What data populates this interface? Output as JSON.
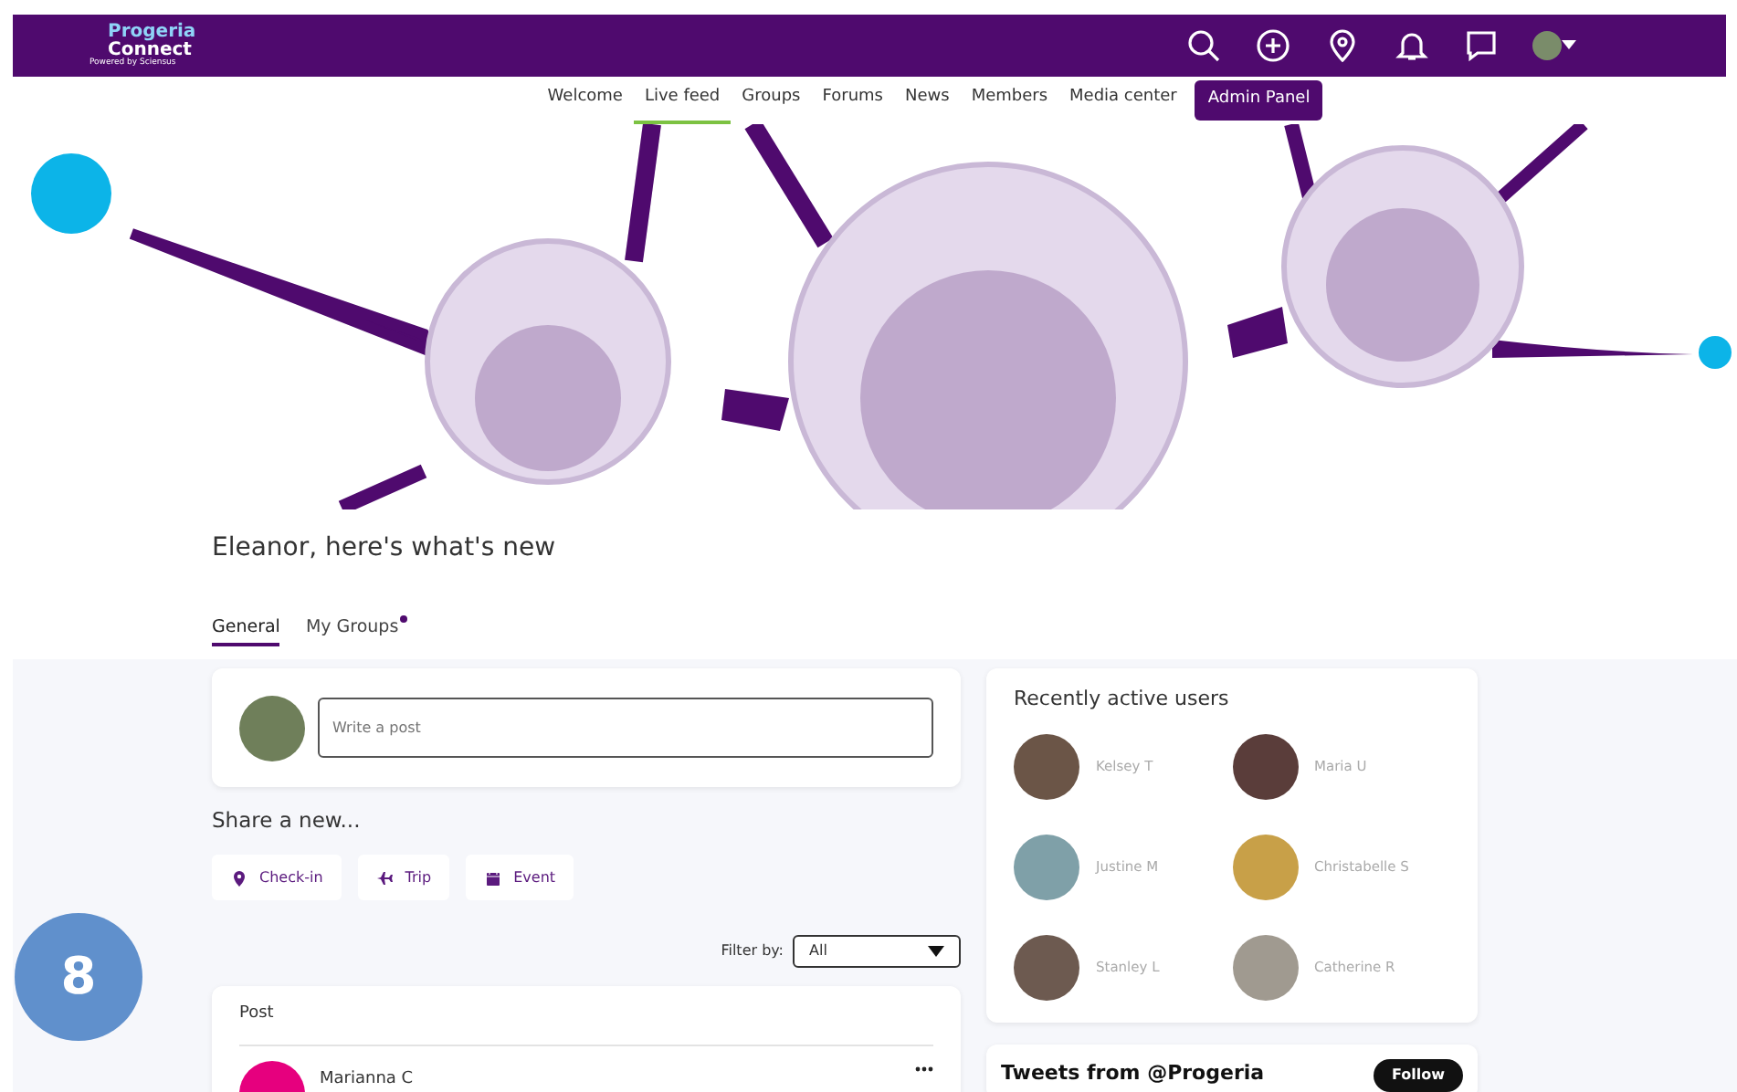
{
  "brand": {
    "line1": "Progeria",
    "line2": "Connect",
    "tagline": "Powered by Sciensus"
  },
  "top_icons": [
    {
      "kind": "search"
    },
    {
      "kind": "plus"
    },
    {
      "kind": "pin"
    },
    {
      "kind": "bell"
    },
    {
      "kind": "chat"
    },
    {
      "kind": "avatar"
    }
  ],
  "nav": [
    {
      "label": "Welcome",
      "selected": false
    },
    {
      "label": "Live feed",
      "selected": true
    },
    {
      "label": "Groups",
      "selected": false
    },
    {
      "label": "Forums",
      "selected": false
    },
    {
      "label": "News",
      "selected": false
    },
    {
      "label": "Members",
      "selected": false
    },
    {
      "label": "Media center",
      "selected": false
    }
  ],
  "admin_button": "Admin Panel",
  "greeting": "Eleanor, here's what's new",
  "feed_tabs": [
    {
      "label": "General",
      "selected": true,
      "notify": false
    },
    {
      "label": "My Groups",
      "selected": false,
      "notify": true
    }
  ],
  "composer": {
    "placeholder": "Write a post"
  },
  "share_title": "Share a new...",
  "share_buttons": [
    {
      "label": "Check-in",
      "kind": "pin"
    },
    {
      "label": "Trip",
      "kind": "plane"
    },
    {
      "label": "Event",
      "kind": "calendar"
    }
  ],
  "filter": {
    "label": "Filter by:",
    "value": "All"
  },
  "post": {
    "title": "Post",
    "author": "Marianna C"
  },
  "active_users": {
    "title": "Recently active users",
    "users": [
      {
        "name": "Kelsey T"
      },
      {
        "name": "Maria U"
      },
      {
        "name": "Justine M"
      },
      {
        "name": "Christabelle S"
      },
      {
        "name": "Stanley L"
      },
      {
        "name": "Catherine R"
      }
    ]
  },
  "tweets": {
    "title": "Tweets from @Progeria",
    "button": "Follow"
  },
  "step_badge": "8"
}
